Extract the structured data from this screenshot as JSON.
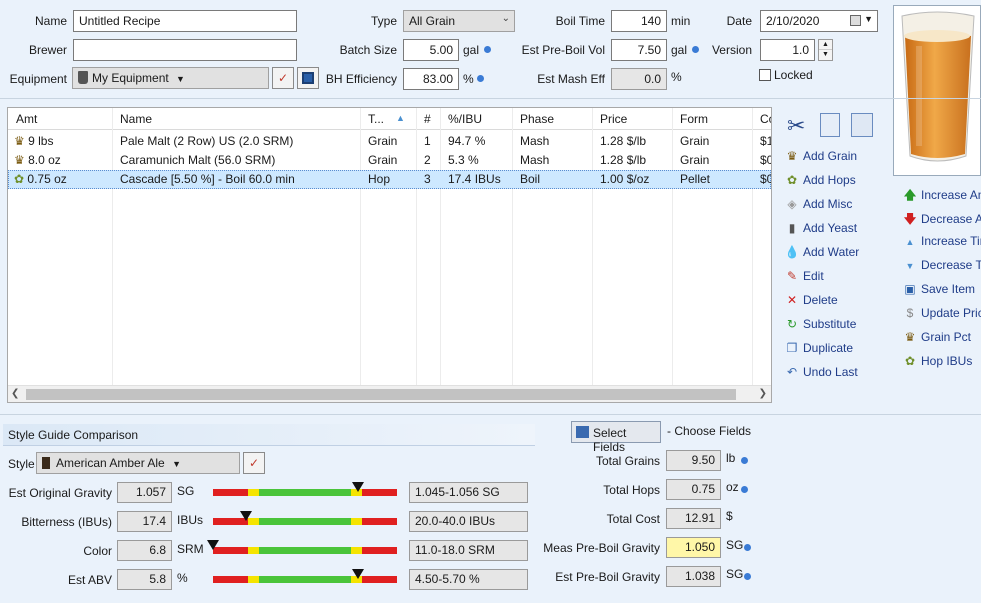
{
  "recipe": {
    "name_label": "Name",
    "name_value": "Untitled Recipe",
    "brewer_label": "Brewer",
    "brewer_value": "",
    "equipment_label": "Equipment",
    "equipment_value": "My Equipment",
    "type_label": "Type",
    "type_value": "All Grain",
    "batch_label": "Batch Size",
    "batch_value": "5.00",
    "batch_unit": "gal",
    "bh_label": "BH Efficiency",
    "bh_value": "83.00",
    "bh_unit": "%",
    "boil_time_label": "Boil Time",
    "boil_time_value": "140",
    "boil_time_unit": "min",
    "pre_boil_label": "Est Pre-Boil Vol",
    "pre_boil_value": "7.50",
    "pre_boil_unit": "gal",
    "mash_eff_label": "Est Mash Eff",
    "mash_eff_value": "0.0",
    "mash_eff_unit": "%",
    "date_label": "Date",
    "date_value": "2/10/2020",
    "version_label": "Version",
    "version_value": "1.0",
    "locked_label": "Locked"
  },
  "grid": {
    "headers": [
      "Amt",
      "Name",
      "T...",
      "#",
      "%/IBU",
      "Phase",
      "Price",
      "Form",
      "Co"
    ],
    "rows": [
      {
        "amt": "9 lbs",
        "name": "Pale Malt (2 Row) US (2.0 SRM)",
        "type": "Grain",
        "num": "1",
        "pct": "94.7 %",
        "phase": "Mash",
        "price": "1.28 $/lb",
        "form": "Grain",
        "cost": "$1",
        "icon": "grain-icon"
      },
      {
        "amt": "8.0 oz",
        "name": "Caramunich Malt (56.0 SRM)",
        "type": "Grain",
        "num": "2",
        "pct": "5.3 %",
        "phase": "Mash",
        "price": "1.28 $/lb",
        "form": "Grain",
        "cost": "$0",
        "icon": "grain-icon"
      },
      {
        "amt": "0.75 oz",
        "name": "Cascade [5.50 %] - Boil 60.0 min",
        "type": "Hop",
        "num": "3",
        "pct": "17.4 IBUs",
        "phase": "Boil",
        "price": "1.00 $/oz",
        "form": "Pellet",
        "cost": "$0",
        "icon": "hop-icon"
      }
    ]
  },
  "actions": [
    {
      "label": "Add Grain",
      "icon": "grain-icon"
    },
    {
      "label": "Add Hops",
      "icon": "hop-icon"
    },
    {
      "label": "Add Misc",
      "icon": "misc-icon"
    },
    {
      "label": "Add Yeast",
      "icon": "yeast-icon"
    },
    {
      "label": "Add Water",
      "icon": "water-icon"
    },
    {
      "label": "Edit",
      "icon": "edit-icon"
    },
    {
      "label": "Delete",
      "icon": "delete-icon"
    },
    {
      "label": "Substitute",
      "icon": "substitute-icon"
    },
    {
      "label": "Duplicate",
      "icon": "duplicate-icon"
    },
    {
      "label": "Undo Last",
      "icon": "undo-icon"
    }
  ],
  "side_actions": [
    {
      "label": "Increase Am",
      "icon": "arrow-up-icon"
    },
    {
      "label": "Decrease Am",
      "icon": "arrow-down-icon"
    },
    {
      "label": "Increase Tin",
      "icon": "triangle-up-icon"
    },
    {
      "label": "Decrease Ti",
      "icon": "triangle-down-icon"
    },
    {
      "label": "Save Item",
      "icon": "save-icon"
    },
    {
      "label": "Update Pric",
      "icon": "dollar-icon"
    },
    {
      "label": "Grain Pct",
      "icon": "grain-icon"
    },
    {
      "label": "Hop IBUs",
      "icon": "hop-icon"
    }
  ],
  "style": {
    "section_title": "Style Guide Comparison",
    "style_label": "Style",
    "style_value": "American Amber Ale",
    "rows": [
      {
        "label": "Est Original Gravity",
        "value": "1.057",
        "unit": "SG",
        "range": "1.045-1.056 SG",
        "marker": 0.79
      },
      {
        "label": "Bitterness (IBUs)",
        "value": "17.4",
        "unit": "IBUs",
        "range": "20.0-40.0 IBUs",
        "marker": 0.18
      },
      {
        "label": "Color",
        "value": "6.8",
        "unit": "SRM",
        "range": "11.0-18.0 SRM",
        "marker": 0.0
      },
      {
        "label": "Est ABV",
        "value": "5.8",
        "unit": "%",
        "range": "4.50-5.70 %",
        "marker": 0.79
      }
    ]
  },
  "fields": {
    "select_label": "Select Fields",
    "choose_label": "- Choose Fields",
    "rows": [
      {
        "label": "Total Grains",
        "value": "9.50",
        "unit": "lb",
        "highlight": false
      },
      {
        "label": "Total Hops",
        "value": "0.75",
        "unit": "oz",
        "highlight": false
      },
      {
        "label": "Total Cost",
        "value": "12.91",
        "unit": "$",
        "highlight": false
      },
      {
        "label": "Meas Pre-Boil Gravity",
        "value": "1.050",
        "unit": "SG",
        "highlight": true
      },
      {
        "label": "Est Pre-Boil Gravity",
        "value": "1.038",
        "unit": "SG",
        "highlight": false
      }
    ]
  },
  "colors": {
    "accent": "#3a7bd5",
    "selection": "#cde8ff",
    "beer": "#e08a2a",
    "highlight": "#fff7a8"
  }
}
